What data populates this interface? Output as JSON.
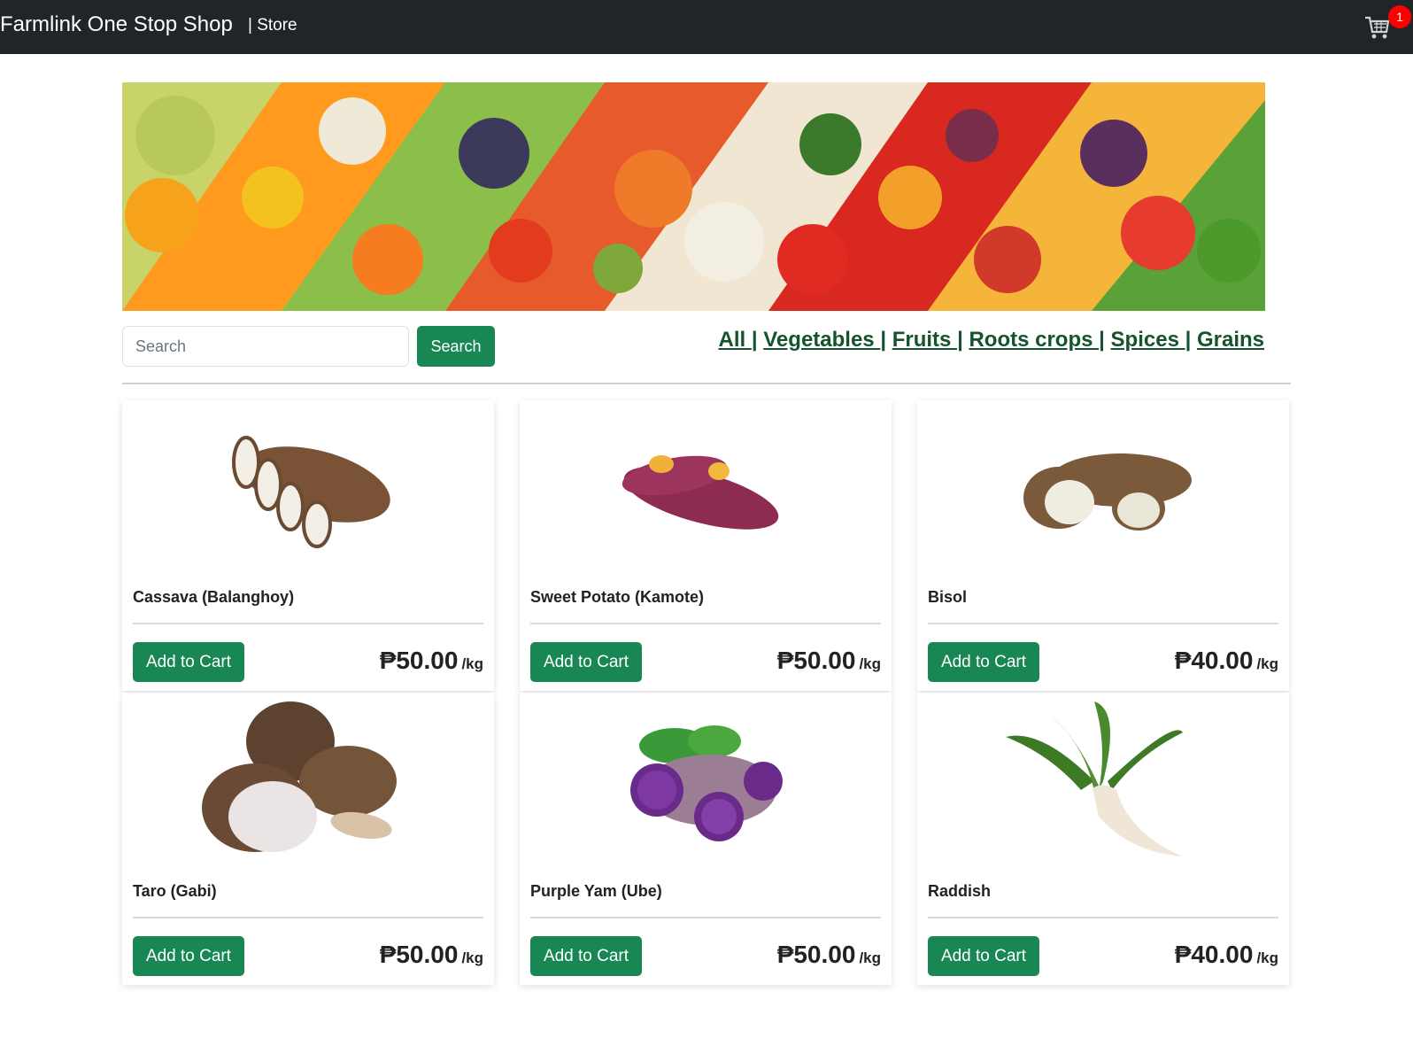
{
  "navbar": {
    "brand": "Farmlink One Stop Shop",
    "store_link": "| Store",
    "cart_icon": "cart-icon",
    "cart_count": "1"
  },
  "search": {
    "placeholder": "Search",
    "button_label": "Search"
  },
  "filters": [
    "All ",
    "Vegetables ",
    "Fruits ",
    "Roots crops ",
    "Spices ",
    "Grains"
  ],
  "colors": {
    "navbar_bg": "#212529",
    "accent": "#198754",
    "badge": "#ff0000"
  },
  "products": [
    {
      "name": "Cassava (Balanghoy)",
      "button": "Add to Cart",
      "price": "₱50.00",
      "unit": "/kg",
      "image": "cassava"
    },
    {
      "name": "Sweet Potato (Kamote)",
      "button": "Add to Cart",
      "price": "₱50.00",
      "unit": "/kg",
      "image": "sweet-potato"
    },
    {
      "name": "Bisol",
      "button": "Add to Cart",
      "price": "₱40.00",
      "unit": "/kg",
      "image": "bisol"
    },
    {
      "name": "Taro (Gabi)",
      "button": "Add to Cart",
      "price": "₱50.00",
      "unit": "/kg",
      "image": "taro"
    },
    {
      "name": "Purple Yam (Ube)",
      "button": "Add to Cart",
      "price": "₱50.00",
      "unit": "/kg",
      "image": "purple-yam"
    },
    {
      "name": "Raddish",
      "button": "Add to Cart",
      "price": "₱40.00",
      "unit": "/kg",
      "image": "radish"
    }
  ]
}
